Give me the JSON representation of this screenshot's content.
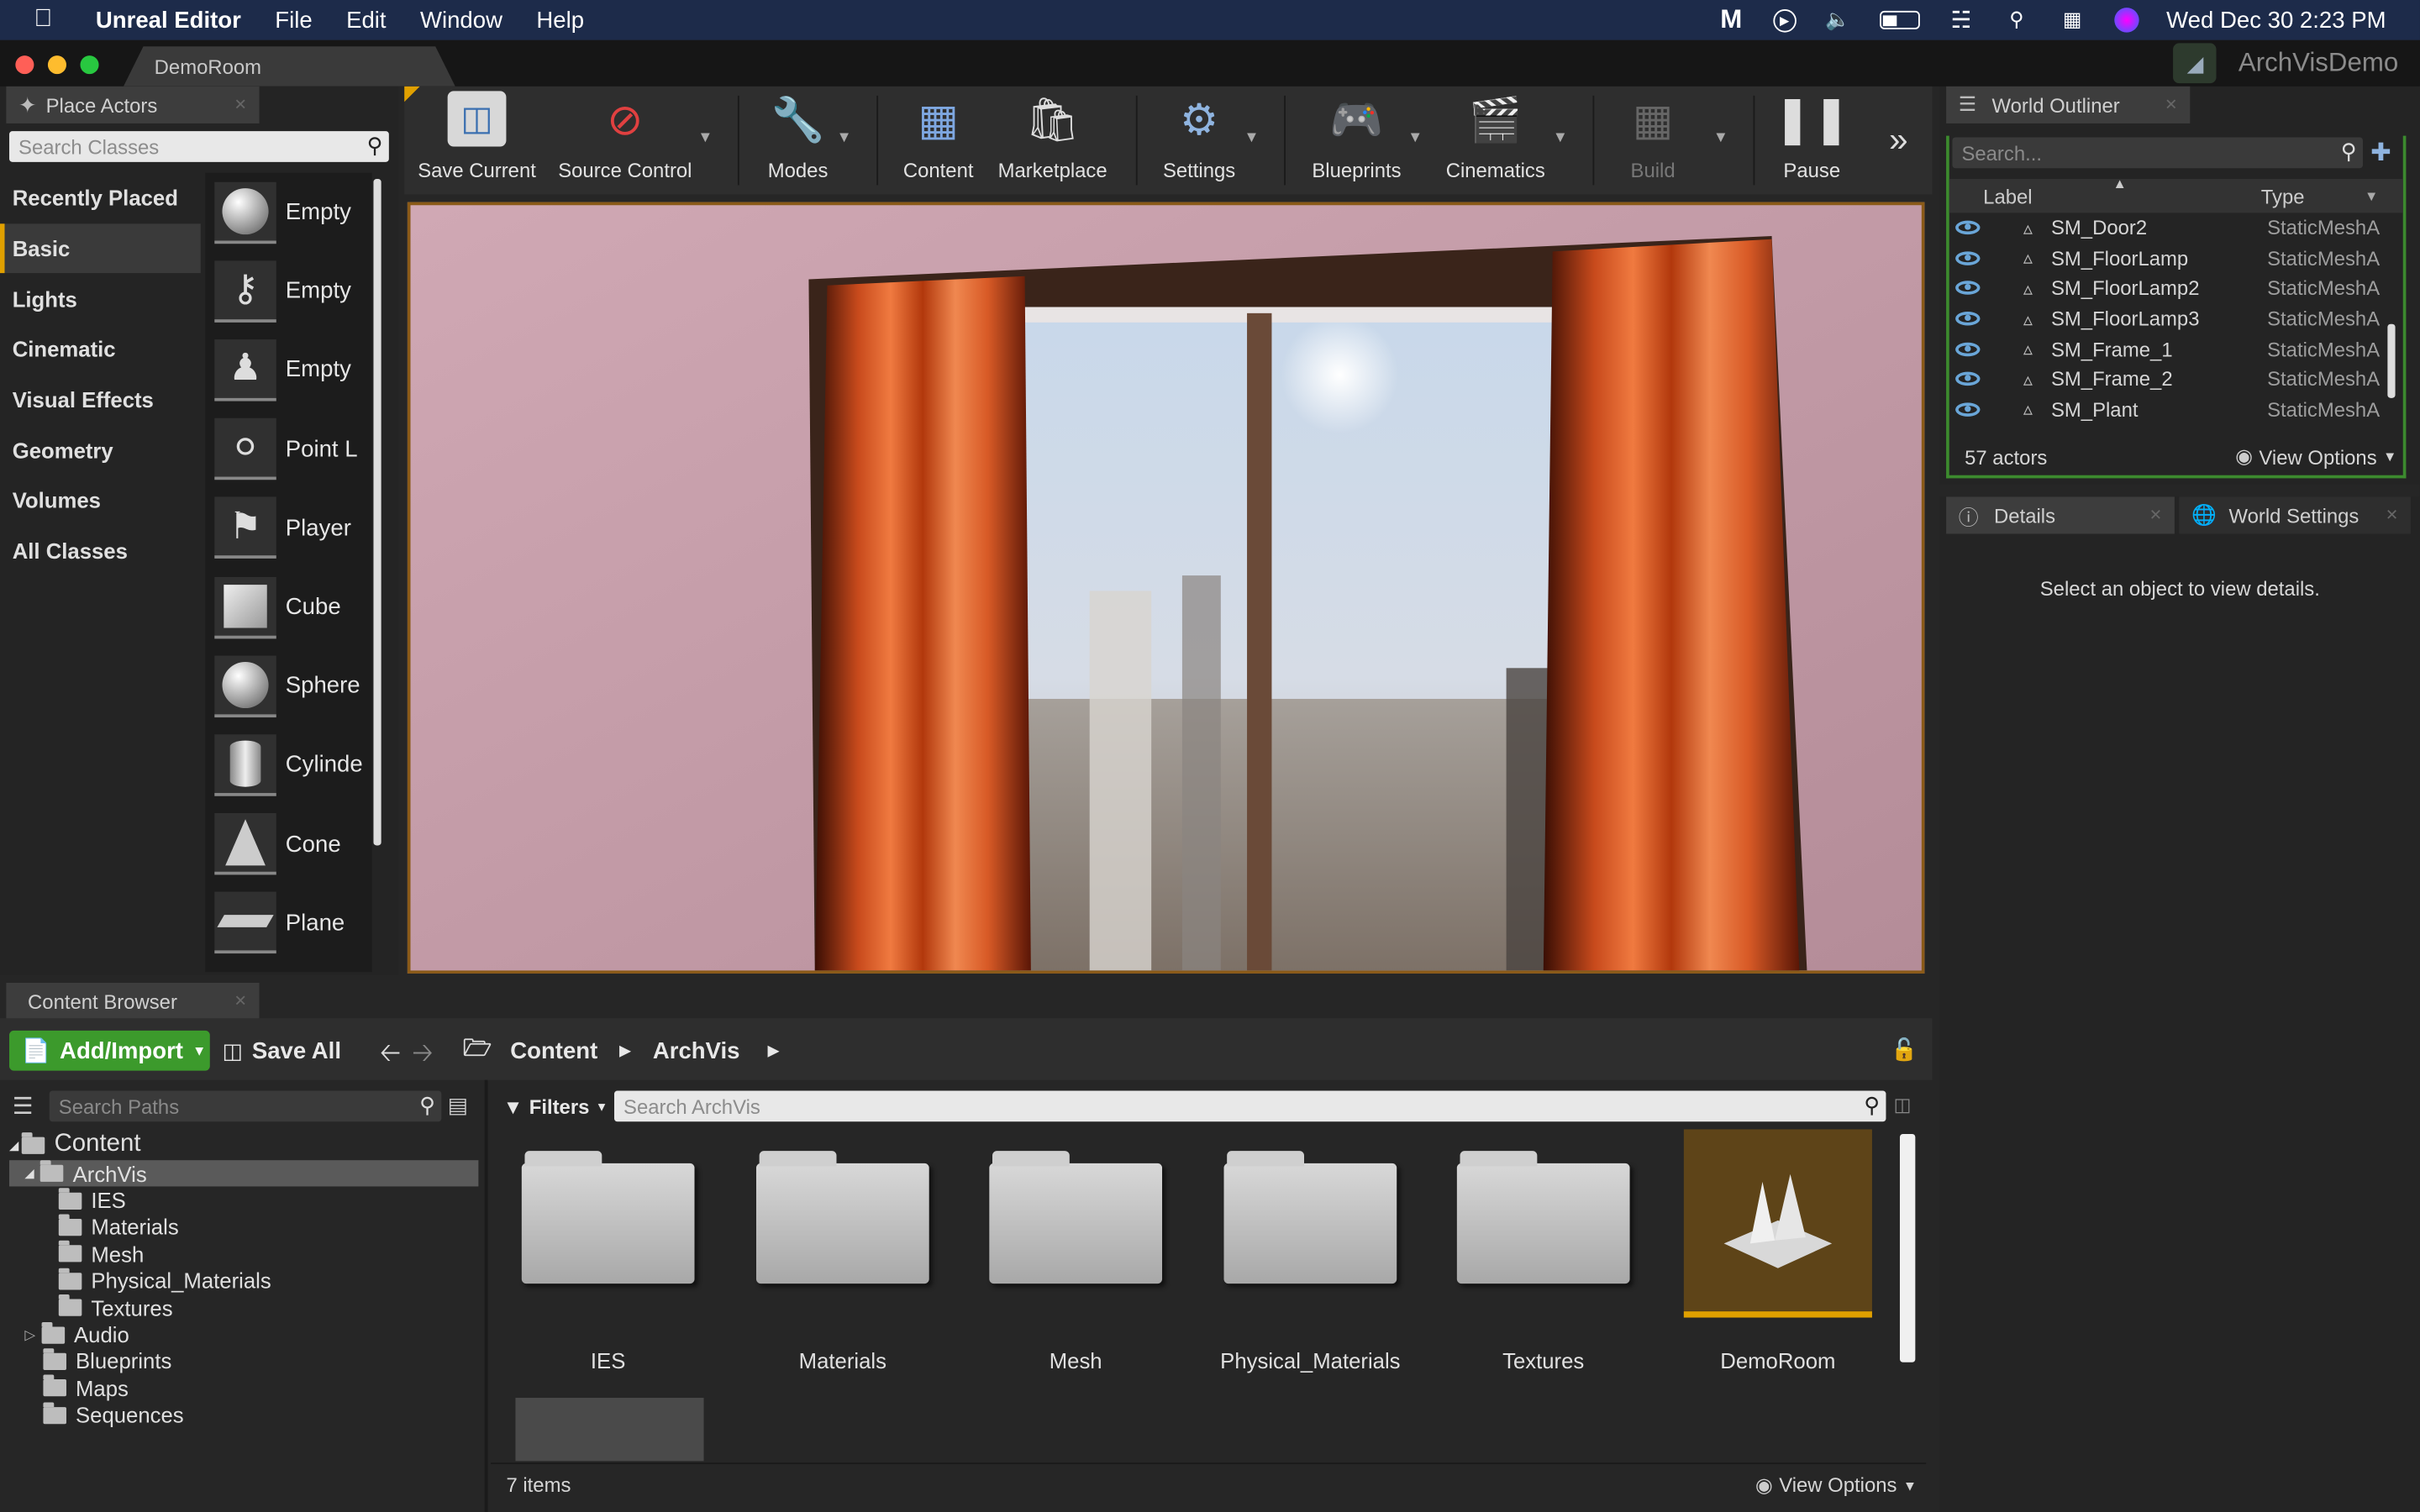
{
  "menubar": {
    "app_name": "Unreal Editor",
    "menus": [
      "File",
      "Edit",
      "Window",
      "Help"
    ],
    "status_icons": [
      "malwarebytes-icon",
      "play-icon",
      "volume-icon",
      "battery-icon",
      "wifi-icon",
      "spotlight-icon",
      "control-center-icon",
      "siri-icon"
    ],
    "clock": "Wed Dec 30  2:23 PM"
  },
  "window": {
    "document_tab": "DemoRoom",
    "project_name": "ArchVisDemo"
  },
  "place_actors": {
    "tab_label": "Place Actors",
    "search_placeholder": "Search Classes",
    "categories": [
      "Recently Placed",
      "Basic",
      "Lights",
      "Cinematic",
      "Visual Effects",
      "Geometry",
      "Volumes",
      "All Classes"
    ],
    "selected_category": "Basic",
    "actors": [
      {
        "label": "Empty",
        "icon": "empty-actor-icon"
      },
      {
        "label": "Empty",
        "icon": "empty-character-icon"
      },
      {
        "label": "Empty",
        "icon": "empty-pawn-icon"
      },
      {
        "label": "Point L",
        "icon": "point-light-icon"
      },
      {
        "label": "Player",
        "icon": "player-start-icon"
      },
      {
        "label": "Cube",
        "icon": "cube-icon"
      },
      {
        "label": "Sphere",
        "icon": "sphere-icon"
      },
      {
        "label": "Cylinde",
        "icon": "cylinder-icon"
      },
      {
        "label": "Cone",
        "icon": "cone-icon"
      },
      {
        "label": "Plane",
        "icon": "plane-icon"
      }
    ]
  },
  "toolbar": {
    "buttons": [
      {
        "label": "Save Current",
        "icon": "save-icon",
        "has_dropdown": false,
        "enabled": true
      },
      {
        "label": "Source Control",
        "icon": "source-control-icon",
        "has_dropdown": true,
        "enabled": true
      },
      {
        "label": "Modes",
        "icon": "modes-icon",
        "has_dropdown": true,
        "enabled": true
      },
      {
        "label": "Content",
        "icon": "content-icon",
        "has_dropdown": false,
        "enabled": true
      },
      {
        "label": "Marketplace",
        "icon": "marketplace-icon",
        "has_dropdown": false,
        "enabled": true
      },
      {
        "label": "Settings",
        "icon": "settings-icon",
        "has_dropdown": true,
        "enabled": true
      },
      {
        "label": "Blueprints",
        "icon": "blueprints-icon",
        "has_dropdown": true,
        "enabled": true
      },
      {
        "label": "Cinematics",
        "icon": "cinematics-icon",
        "has_dropdown": true,
        "enabled": true
      },
      {
        "label": "Build",
        "icon": "build-icon",
        "has_dropdown": true,
        "enabled": false
      },
      {
        "label": "Pause",
        "icon": "pause-icon",
        "has_dropdown": false,
        "enabled": true
      }
    ],
    "overflow_icon": "chevron-double-right-icon"
  },
  "world_outliner": {
    "tab_label": "World Outliner",
    "search_placeholder": "Search...",
    "columns": [
      "Label",
      "Type"
    ],
    "rows": [
      {
        "label": "SM_Door2",
        "type": "StaticMeshA"
      },
      {
        "label": "SM_FloorLamp",
        "type": "StaticMeshA"
      },
      {
        "label": "SM_FloorLamp2",
        "type": "StaticMeshA"
      },
      {
        "label": "SM_FloorLamp3",
        "type": "StaticMeshA"
      },
      {
        "label": "SM_Frame_1",
        "type": "StaticMeshA"
      },
      {
        "label": "SM_Frame_2",
        "type": "StaticMeshA"
      },
      {
        "label": "SM_Plant",
        "type": "StaticMeshA"
      }
    ],
    "actor_count": "57 actors",
    "view_options": "View Options"
  },
  "details": {
    "tabs": [
      "Details",
      "World Settings"
    ],
    "empty_message": "Select an object to view details."
  },
  "content_browser": {
    "tab_label": "Content Browser",
    "add_import": "Add/Import",
    "save_all": "Save All",
    "breadcrumbs": [
      "Content",
      "ArchVis"
    ],
    "search_paths_placeholder": "Search Paths",
    "filters": "Filters",
    "search_placeholder": "Search ArchVis",
    "tree": [
      {
        "label": "Content",
        "depth": 0,
        "expanded": true
      },
      {
        "label": "ArchVis",
        "depth": 1,
        "expanded": true,
        "selected": true
      },
      {
        "label": "IES",
        "depth": 2
      },
      {
        "label": "Materials",
        "depth": 2
      },
      {
        "label": "Mesh",
        "depth": 2
      },
      {
        "label": "Physical_Materials",
        "depth": 2
      },
      {
        "label": "Textures",
        "depth": 2
      },
      {
        "label": "Audio",
        "depth": 1,
        "collapsed": true
      },
      {
        "label": "Blueprints",
        "depth": 1
      },
      {
        "label": "Maps",
        "depth": 1
      },
      {
        "label": "Sequences",
        "depth": 1
      }
    ],
    "assets": [
      {
        "name": "IES",
        "kind": "folder"
      },
      {
        "name": "Materials",
        "kind": "folder"
      },
      {
        "name": "Mesh",
        "kind": "folder"
      },
      {
        "name": "Physical_Materials",
        "kind": "folder"
      },
      {
        "name": "Textures",
        "kind": "folder"
      },
      {
        "name": "DemoRoom",
        "kind": "map"
      }
    ],
    "item_count": "7 items",
    "view_options": "View Options"
  },
  "colors": {
    "accent_orange": "#e0a000",
    "outliner_green": "#3c8a2e",
    "add_import_green": "#3c9a2c",
    "mac_menubar": "#1d2b4a"
  }
}
